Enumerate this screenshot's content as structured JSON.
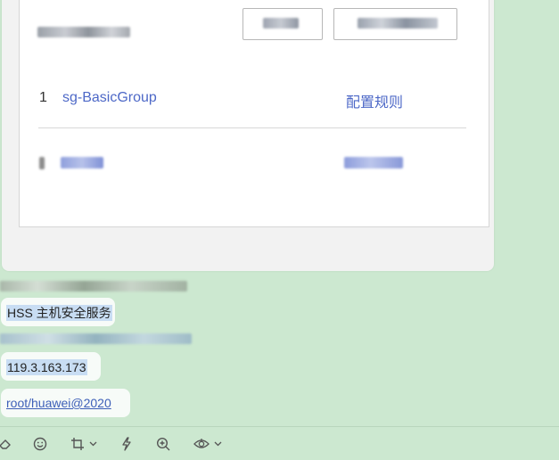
{
  "card": {
    "row_number": "1",
    "row_name": "sg-BasicGroup",
    "row_action": "配置规则"
  },
  "messages": {
    "msg1": "HSS 主机安全服务",
    "msg2": "119.3.163.173",
    "msg3": "root/huawei@2020"
  },
  "toolbar": {
    "icons": [
      "eraser-icon",
      "emoji-icon",
      "crop-icon",
      "lightning-icon",
      "zoom-in-icon",
      "eye-icon"
    ]
  },
  "colors": {
    "background": "#cce8d0",
    "link": "#4d68c7",
    "highlight": "#c8ddf3"
  }
}
